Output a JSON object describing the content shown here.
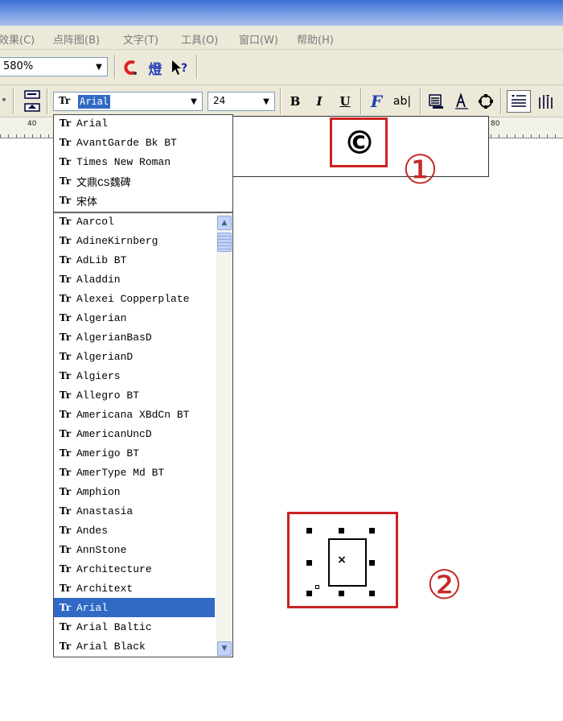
{
  "menubar": {
    "items": [
      "效果(C)",
      "点阵图(B)",
      "文字(T)",
      "工具(O)",
      "窗口(W)",
      "帮助(H)"
    ]
  },
  "toolbar1": {
    "zoom_value": "580%"
  },
  "toolbar2": {
    "font_name": "Arial",
    "font_size": "24",
    "bold_label": "B",
    "italic_label": "I",
    "underline_label": "U",
    "text_tool_label": "ab|"
  },
  "ruler": {
    "labels": [
      "40",
      "80"
    ]
  },
  "canvas": {
    "copyright_symbol": "©",
    "marker_1": "①",
    "marker_2": "②"
  },
  "font_dropdown": {
    "recent_fonts": [
      "Arial",
      "AvantGarde Bk BT",
      "Times New Roman",
      "文鼎CS魏碑",
      "宋体"
    ],
    "fonts": [
      "Aarcol",
      "AdineKirnberg",
      "AdLib BT",
      "Aladdin",
      "Alexei Copperplate",
      "Algerian",
      "AlgerianBasD",
      "AlgerianD",
      "Algiers",
      "Allegro BT",
      "Americana XBdCn BT",
      "AmericanUncD",
      "Amerigo BT",
      "AmerType Md BT",
      "Amphion",
      "Anastasia",
      "Andes",
      "AnnStone",
      "Architecture",
      "Architext",
      "Arial",
      "Arial Baltic",
      "Arial Black"
    ],
    "selected_font": "Arial",
    "font_icon": "Tr"
  }
}
